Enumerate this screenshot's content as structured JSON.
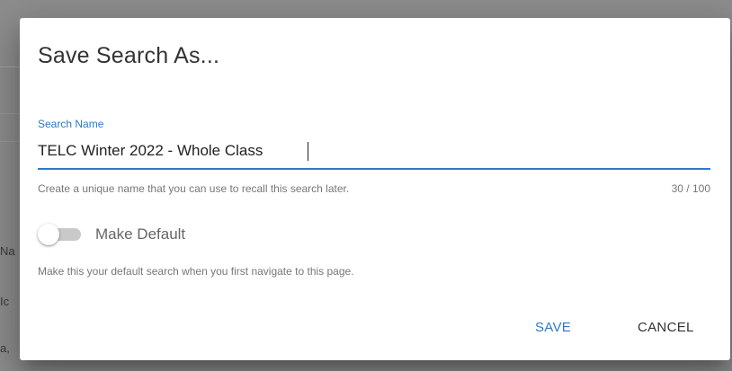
{
  "background": {
    "fragments": [
      "Na",
      "Ic",
      "a,"
    ]
  },
  "dialog": {
    "title": "Save Search As...",
    "search_name": {
      "label": "Search Name",
      "value": "TELC Winter 2022 - Whole Class",
      "hint": "Create a unique name that you can use to recall this search later.",
      "counter": "30 / 100"
    },
    "make_default": {
      "label": "Make Default",
      "checked": false,
      "hint": "Make this your default search when you first navigate to this page."
    },
    "actions": {
      "save_label": "SAVE",
      "cancel_label": "CANCEL"
    },
    "colors": {
      "accent": "#2f78c4",
      "overlay": "#8f8f8f"
    }
  }
}
